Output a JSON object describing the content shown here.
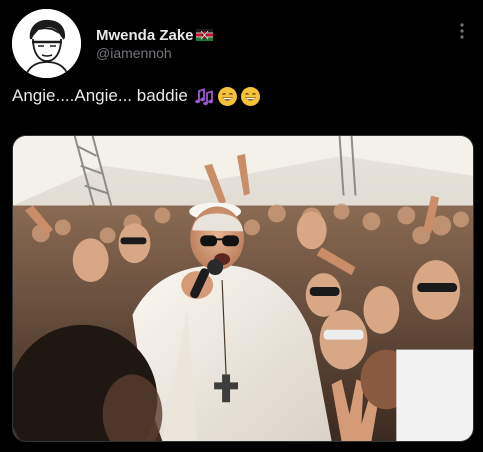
{
  "tweet": {
    "author": {
      "display_name": "Mwenda Zake",
      "handle": "@iamennoh",
      "flag_icon": "kenya-flag-icon",
      "avatar_icon": "sketch-avatar-icon"
    },
    "more_icon": "more-vertical-icon",
    "text": "Angie....Angie... baddie",
    "emojis": [
      "musical-notes-icon",
      "grinning-face-icon",
      "grinning-face-icon"
    ],
    "media": {
      "kind": "photo",
      "description_icon": "crowd-photo"
    }
  },
  "colors": {
    "background": "#000000",
    "primary_text": "#e7e9ea",
    "secondary_text": "#71767b",
    "border": "#2f3336",
    "music_purple": "#9b59d0",
    "emoji_yellow": "#f7c23a"
  }
}
